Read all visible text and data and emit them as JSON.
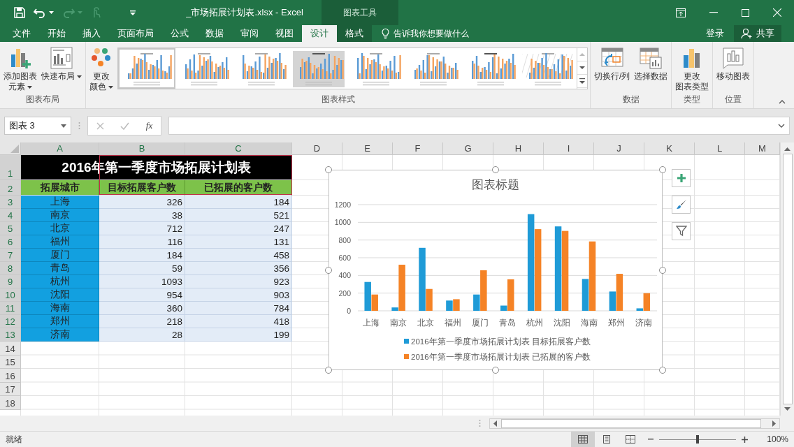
{
  "window": {
    "title": "_市场拓展计划表.xlsx - Excel",
    "context_tools": "图表工具"
  },
  "menu_tabs": [
    {
      "label": "文件",
      "selected": false,
      "kind": "file"
    },
    {
      "label": "开始",
      "selected": false,
      "kind": "normal"
    },
    {
      "label": "插入",
      "selected": false,
      "kind": "normal"
    },
    {
      "label": "页面布局",
      "selected": false,
      "kind": "normal"
    },
    {
      "label": "公式",
      "selected": false,
      "kind": "normal"
    },
    {
      "label": "数据",
      "selected": false,
      "kind": "normal"
    },
    {
      "label": "审阅",
      "selected": false,
      "kind": "normal"
    },
    {
      "label": "视图",
      "selected": false,
      "kind": "normal"
    },
    {
      "label": "设计",
      "selected": true,
      "kind": "context"
    },
    {
      "label": "格式",
      "selected": false,
      "kind": "context"
    }
  ],
  "tell_me": "告诉我你想要做什么",
  "sign_in": "登录",
  "share": "共享",
  "ribbon": {
    "groups": [
      {
        "label": "图表布局",
        "buttons": [
          {
            "lines": [
              "添加图表",
              "元素"
            ],
            "dropdown": true
          },
          {
            "lines": [
              "快速布局"
            ],
            "dropdown": true
          }
        ]
      },
      {
        "label": "图表样式",
        "buttons": [
          {
            "lines": [
              "更改",
              "颜色"
            ],
            "dropdown": true
          }
        ],
        "styles": [
          {
            "selected": true
          },
          {
            "selected": false
          },
          {
            "selected": false
          },
          {
            "selected": false
          },
          {
            "selected": false
          },
          {
            "selected": false
          },
          {
            "selected": false
          },
          {
            "selected": false
          }
        ]
      },
      {
        "label": "数据",
        "buttons": [
          {
            "lines": [
              "切换行/列"
            ],
            "dropdown": false
          },
          {
            "lines": [
              "选择数据"
            ],
            "dropdown": false
          }
        ]
      },
      {
        "label": "类型",
        "buttons": [
          {
            "lines": [
              "更改",
              "图表类型"
            ],
            "dropdown": false
          }
        ]
      },
      {
        "label": "位置",
        "buttons": [
          {
            "lines": [
              "移动图表"
            ],
            "dropdown": false
          }
        ]
      }
    ]
  },
  "name_box": "图表 3",
  "function_label": "fx",
  "columns": [
    "A",
    "B",
    "C",
    "D",
    "E",
    "F",
    "G",
    "H",
    "I",
    "J",
    "K",
    "L",
    "M"
  ],
  "row_numbers": [
    "1",
    "2",
    "3",
    "4",
    "5",
    "6",
    "7",
    "8",
    "9",
    "10",
    "11",
    "12",
    "13",
    "14",
    "15",
    "16",
    "17",
    "18"
  ],
  "sheet": {
    "title": "2016年第一季度市场拓展计划表",
    "headers": [
      "拓展城市",
      "目标拓展客户数",
      "已拓展的客户数"
    ],
    "rows": [
      [
        "上海",
        "326",
        "184"
      ],
      [
        "南京",
        "38",
        "521"
      ],
      [
        "北京",
        "712",
        "247"
      ],
      [
        "福州",
        "116",
        "131"
      ],
      [
        "厦门",
        "184",
        "458"
      ],
      [
        "青岛",
        "59",
        "356"
      ],
      [
        "杭州",
        "1093",
        "923"
      ],
      [
        "沈阳",
        "954",
        "903"
      ],
      [
        "海南",
        "360",
        "784"
      ],
      [
        "郑州",
        "218",
        "418"
      ],
      [
        "济南",
        "28",
        "199"
      ]
    ]
  },
  "chart_data": {
    "type": "bar",
    "title": "图表标题",
    "categories": [
      "上海",
      "南京",
      "北京",
      "福州",
      "厦门",
      "青岛",
      "杭州",
      "沈阳",
      "海南",
      "郑州",
      "济南"
    ],
    "series": [
      {
        "name": "2016年第一季度市场拓展计划表 目标拓展客户数",
        "color": "#1f9bd7",
        "values": [
          326,
          38,
          712,
          116,
          184,
          59,
          1093,
          954,
          360,
          218,
          28
        ]
      },
      {
        "name": "2016年第一季度市场拓展计划表 已拓展的客户数",
        "color": "#f58326",
        "values": [
          184,
          521,
          247,
          131,
          458,
          356,
          923,
          903,
          784,
          418,
          199
        ]
      }
    ],
    "ylim": [
      0,
      1200
    ],
    "yticks": [
      0,
      200,
      400,
      600,
      800,
      1000,
      1200
    ],
    "grid": true,
    "legend": "bottom"
  },
  "status": "就绪",
  "views": [
    {
      "selected": true
    },
    {
      "selected": false
    },
    {
      "selected": false
    }
  ],
  "zoom_slider": {
    "level": 0.5
  },
  "zoom": "100%"
}
